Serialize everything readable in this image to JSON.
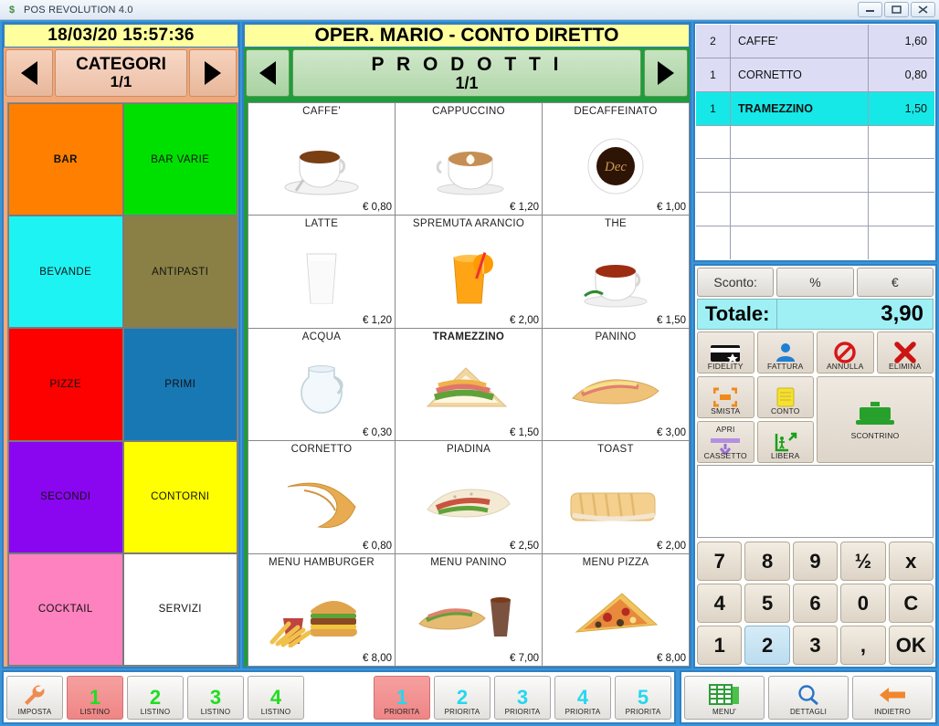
{
  "window": {
    "title": "POS REVOLUTION 4.0",
    "app_icon": "dollar-icon",
    "controls": {
      "minimize": "–",
      "maximize": "□",
      "close": "✕"
    }
  },
  "clock": {
    "value": "18/03/20 15:57:36"
  },
  "operator_bar": {
    "text": "OPER. MARIO - CONTO DIRETTO"
  },
  "categories_panel": {
    "title": "CATEGORI",
    "page": "1/1",
    "prev_icon": "triangle-left-icon",
    "next_icon": "triangle-right-icon",
    "items": [
      {
        "label": "BAR",
        "color": "#ff8000",
        "text_color": "#111111",
        "bold": true
      },
      {
        "label": "BAR VARIE",
        "color": "#00e000",
        "text_color": "#111111",
        "bold": false
      },
      {
        "label": "BEVANDE",
        "color": "#1ef3f3",
        "text_color": "#111111",
        "bold": false
      },
      {
        "label": "ANTIPASTI",
        "color": "#8a8045",
        "text_color": "#111111",
        "bold": false
      },
      {
        "label": "PIZZE",
        "color": "#fd0000",
        "text_color": "#111111",
        "bold": false
      },
      {
        "label": "PRIMI",
        "color": "#1878b4",
        "text_color": "#111111",
        "bold": false
      },
      {
        "label": "SECONDI",
        "color": "#8b06f0",
        "text_color": "#111111",
        "bold": false
      },
      {
        "label": "CONTORNI",
        "color": "#ffff00",
        "text_color": "#111111",
        "bold": false
      },
      {
        "label": "COCKTAIL",
        "color": "#ff82c0",
        "text_color": "#111111",
        "bold": false
      },
      {
        "label": "SERVIZI",
        "color": "#ffffff",
        "text_color": "#111111",
        "bold": false
      }
    ]
  },
  "products_panel": {
    "title": "P R O D O T T I",
    "page": "1/1",
    "prev_icon": "triangle-left-icon",
    "next_icon": "triangle-right-icon",
    "items": [
      {
        "name": "CAFFE'",
        "price": "€ 0,80",
        "icon": "espresso-cup-icon",
        "selected": false
      },
      {
        "name": "CAPPUCCINO",
        "price": "€ 1,20",
        "icon": "cappuccino-cup-icon",
        "selected": false
      },
      {
        "name": "DECAFFEINATO",
        "price": "€ 1,00",
        "icon": "decaf-cup-icon",
        "selected": false
      },
      {
        "name": "LATTE",
        "price": "€ 1,20",
        "icon": "milk-glass-icon",
        "selected": false
      },
      {
        "name": "SPREMUTA ARANCIO",
        "price": "€ 2,00",
        "icon": "orange-juice-icon",
        "selected": false
      },
      {
        "name": "THE",
        "price": "€ 1,50",
        "icon": "tea-cup-icon",
        "selected": false
      },
      {
        "name": "ACQUA",
        "price": "€ 0,30",
        "icon": "water-jug-icon",
        "selected": false
      },
      {
        "name": "TRAMEZZINO",
        "price": "€ 1,50",
        "icon": "sandwich-icon",
        "selected": true
      },
      {
        "name": "PANINO",
        "price": "€ 3,00",
        "icon": "baguette-icon",
        "selected": false
      },
      {
        "name": "CORNETTO",
        "price": "€ 0,80",
        "icon": "croissant-icon",
        "selected": false
      },
      {
        "name": "PIADINA",
        "price": "€ 2,50",
        "icon": "piadina-icon",
        "selected": false
      },
      {
        "name": "TOAST",
        "price": "€ 2,00",
        "icon": "toast-icon",
        "selected": false
      },
      {
        "name": "MENU HAMBURGER",
        "price": "€ 8,00",
        "icon": "burger-meal-icon",
        "selected": false
      },
      {
        "name": "MENU PANINO",
        "price": "€ 7,00",
        "icon": "panino-meal-icon",
        "selected": false
      },
      {
        "name": "MENU PIZZA",
        "price": "€ 8,00",
        "icon": "pizza-slice-icon",
        "selected": false
      }
    ]
  },
  "receipt": {
    "rows": [
      {
        "qty": "2",
        "name": "CAFFE'",
        "price": "1,60",
        "state": "filled"
      },
      {
        "qty": "1",
        "name": "CORNETTO",
        "price": "0,80",
        "state": "filled"
      },
      {
        "qty": "1",
        "name": "TRAMEZZINO",
        "price": "1,50",
        "state": "active"
      },
      {
        "qty": "",
        "name": "",
        "price": "",
        "state": "empty"
      },
      {
        "qty": "",
        "name": "",
        "price": "",
        "state": "empty"
      },
      {
        "qty": "",
        "name": "",
        "price": "",
        "state": "empty"
      },
      {
        "qty": "",
        "name": "",
        "price": "",
        "state": "empty"
      }
    ]
  },
  "discount": {
    "label": "Sconto:",
    "percent_label": "%",
    "euro_label": "€"
  },
  "total": {
    "label": "Totale:",
    "value": "3,90"
  },
  "function_buttons": [
    {
      "label": "FIDELITY",
      "icon": "credit-card-icon"
    },
    {
      "label": "FATTURA",
      "icon": "person-icon"
    },
    {
      "label": "ANNULLA",
      "icon": "no-entry-icon"
    },
    {
      "label": "ELIMINA",
      "icon": "red-x-icon"
    },
    {
      "label": "SMISTA",
      "icon": "split-arrows-icon"
    },
    {
      "label": "CONTO",
      "icon": "yellow-note-icon"
    },
    {
      "label_top": "APRI",
      "label": "CASSETTO",
      "icon": "open-drawer-icon"
    },
    {
      "label": "LIBERA",
      "icon": "exit-door-icon"
    },
    {
      "label": "SCONTRINO",
      "icon": "printer-icon"
    }
  ],
  "keypad": {
    "keys": [
      {
        "label": "7",
        "highlight": false
      },
      {
        "label": "8",
        "highlight": false
      },
      {
        "label": "9",
        "highlight": false
      },
      {
        "label": "½",
        "highlight": false
      },
      {
        "label": "x",
        "highlight": false
      },
      {
        "label": "4",
        "highlight": false
      },
      {
        "label": "5",
        "highlight": false
      },
      {
        "label": "6",
        "highlight": false
      },
      {
        "label": "0",
        "highlight": false
      },
      {
        "label": "C",
        "highlight": false
      },
      {
        "label": "1",
        "highlight": false
      },
      {
        "label": "2",
        "highlight": true
      },
      {
        "label": "3",
        "highlight": false
      },
      {
        "label": ",",
        "highlight": false
      },
      {
        "label": "OK",
        "highlight": false
      }
    ]
  },
  "bottom_toolbar": {
    "left": [
      {
        "label": "IMPOSTA",
        "num": "",
        "icon": "wrench-icon",
        "active": false,
        "num_color": ""
      },
      {
        "label": "LISTINO",
        "num": "1",
        "icon": "",
        "active": true,
        "num_color": "green"
      },
      {
        "label": "LISTINO",
        "num": "2",
        "icon": "",
        "active": false,
        "num_color": "green"
      },
      {
        "label": "LISTINO",
        "num": "3",
        "icon": "",
        "active": false,
        "num_color": "green"
      },
      {
        "label": "LISTINO",
        "num": "4",
        "icon": "",
        "active": false,
        "num_color": "green"
      }
    ],
    "priority": [
      {
        "label": "PRIORITA",
        "num": "1",
        "active": true,
        "num_color": "cyan"
      },
      {
        "label": "PRIORITA",
        "num": "2",
        "active": false,
        "num_color": "cyan"
      },
      {
        "label": "PRIORITA",
        "num": "3",
        "active": false,
        "num_color": "cyan"
      },
      {
        "label": "PRIORITA",
        "num": "4",
        "active": false,
        "num_color": "cyan"
      },
      {
        "label": "PRIORITA",
        "num": "5",
        "active": false,
        "num_color": "cyan"
      }
    ],
    "right": [
      {
        "label": "MENU'",
        "icon": "menu-grid-icon"
      },
      {
        "label": "DETTAGLI",
        "icon": "magnifier-icon"
      },
      {
        "label": "INDIETRO",
        "icon": "back-arrow-icon"
      }
    ]
  }
}
